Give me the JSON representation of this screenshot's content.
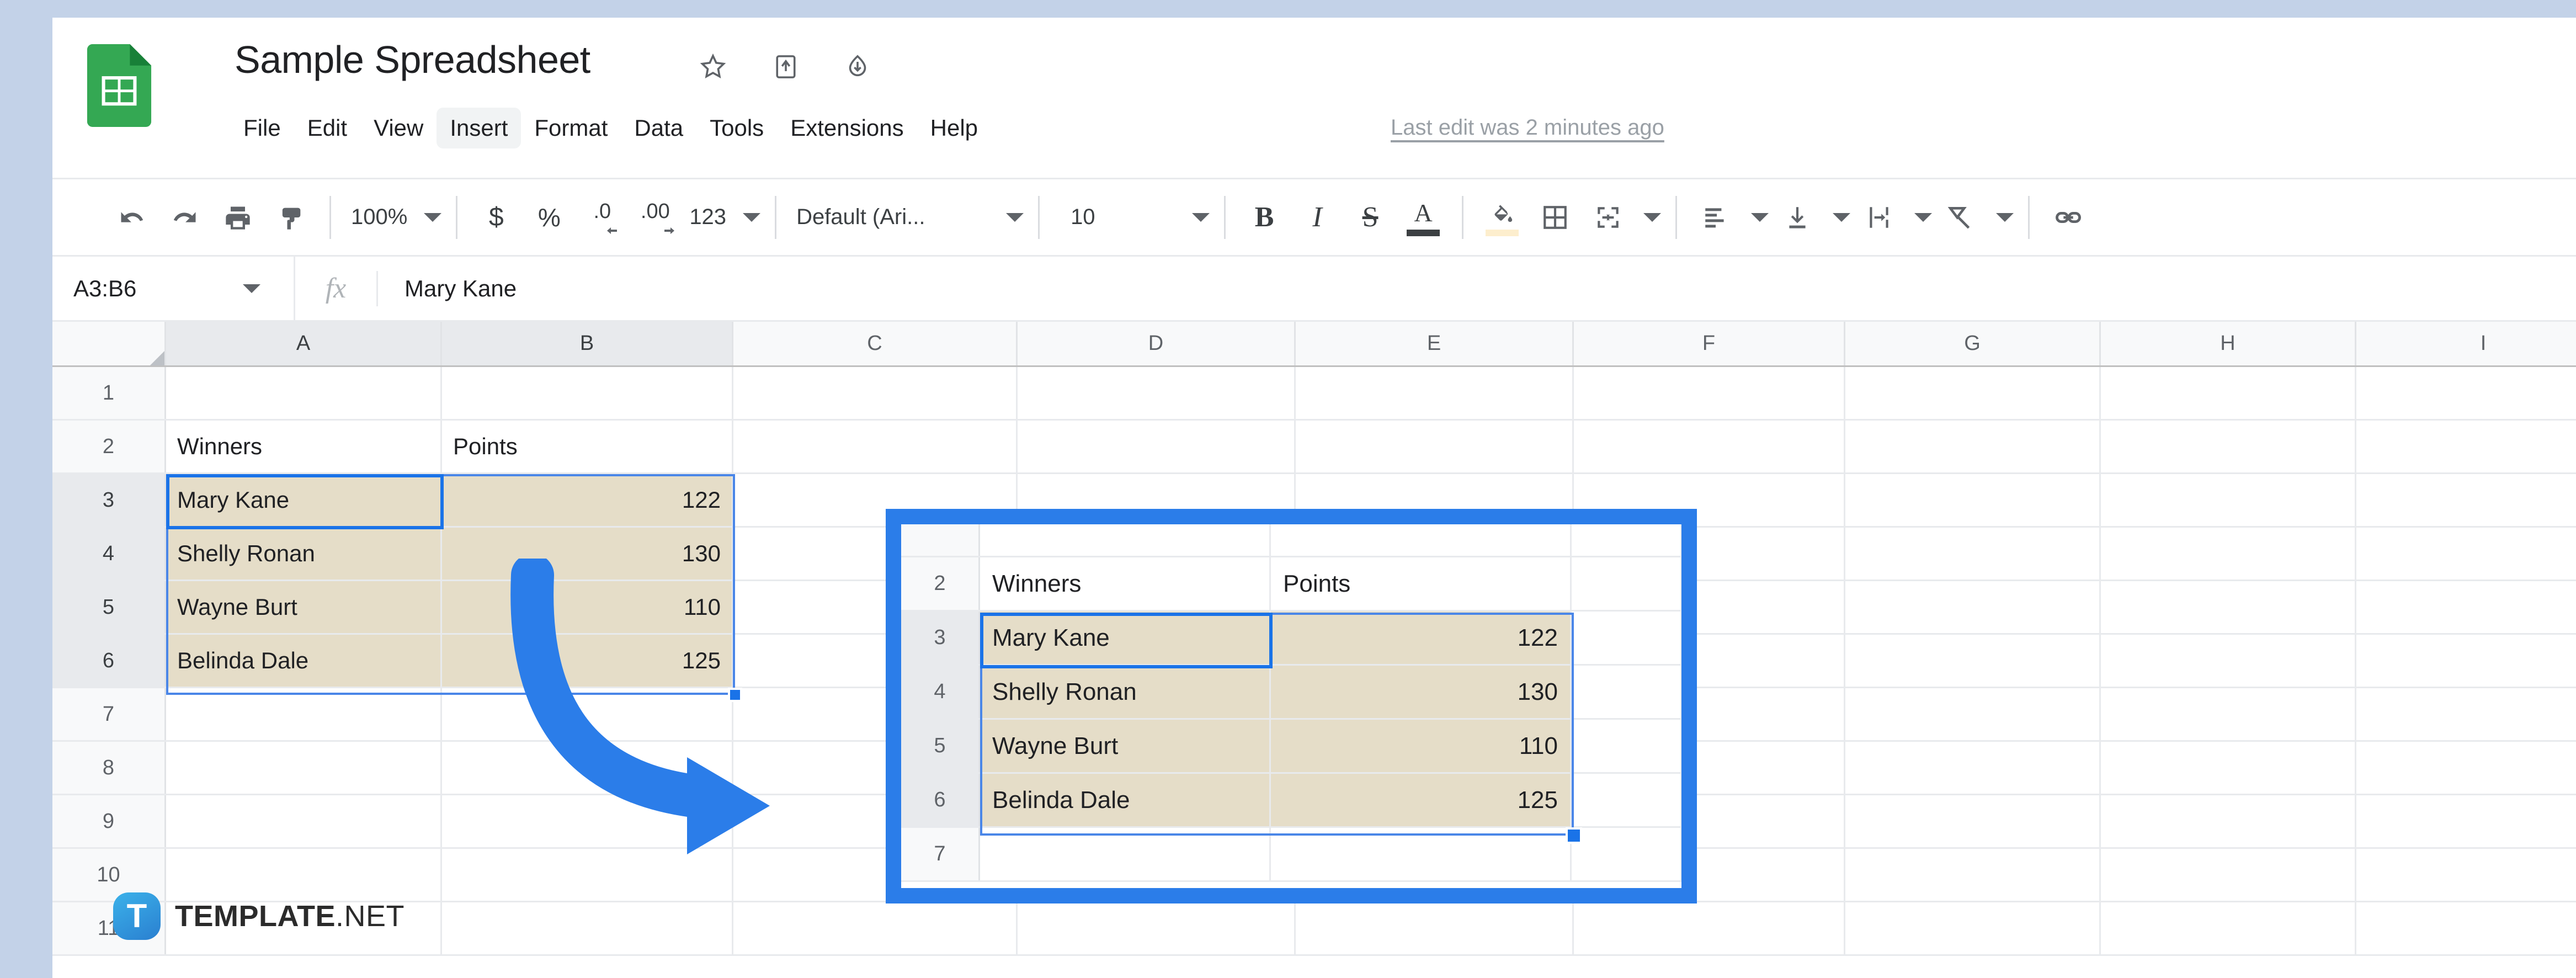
{
  "app": {
    "title": "Sample Spreadsheet",
    "logo_icon": "sheets-icon",
    "title_icons": [
      "star-icon",
      "move-to-folder-icon",
      "cloud-saved-icon"
    ],
    "last_edit": "Last edit was 2 minutes ago"
  },
  "menubar": [
    {
      "label": "File",
      "active": false
    },
    {
      "label": "Edit",
      "active": false
    },
    {
      "label": "View",
      "active": false
    },
    {
      "label": "Insert",
      "active": true
    },
    {
      "label": "Format",
      "active": false
    },
    {
      "label": "Data",
      "active": false
    },
    {
      "label": "Tools",
      "active": false
    },
    {
      "label": "Extensions",
      "active": false
    },
    {
      "label": "Help",
      "active": false
    }
  ],
  "toolbar": {
    "zoom_value": "100%",
    "number_format_value": "123",
    "font_value": "Default (Ari...",
    "font_size_value": "10",
    "icons": [
      "undo-icon",
      "redo-icon",
      "print-icon",
      "paint-format-icon",
      "currency-icon",
      "percent-icon",
      "decrease-decimal-icon",
      "increase-decimal-icon",
      "bold-icon",
      "italic-icon",
      "strikethrough-icon",
      "text-color-icon",
      "fill-color-icon",
      "borders-icon",
      "merge-cells-icon",
      "horizontal-align-icon",
      "vertical-align-icon",
      "text-wrap-icon",
      "text-rotation-icon",
      "insert-link-icon"
    ],
    "currency_label": "$",
    "percent_label": "%",
    "decrease_decimal_label": ".0",
    "increase_decimal_label": ".00"
  },
  "formula_bar": {
    "name_box": "A3:B6",
    "fx_label": "fx",
    "value": "Mary Kane"
  },
  "grid": {
    "columns": [
      "A",
      "B",
      "C",
      "D",
      "E",
      "F",
      "G",
      "H",
      "I"
    ],
    "selected_columns": [
      "A",
      "B"
    ],
    "rows": [
      "1",
      "2",
      "3",
      "4",
      "5",
      "6",
      "7",
      "8",
      "9",
      "10",
      "11"
    ],
    "selected_rows": [
      "3",
      "4",
      "5",
      "6"
    ],
    "cells": {
      "A2": "Winners",
      "B2": "Points",
      "A3": "Mary Kane",
      "B3": "122",
      "A4": "Shelly Ronan",
      "B4": "130",
      "A5": "Wayne Burt",
      "B5": "110",
      "A6": "Belinda Dale",
      "B6": "125"
    },
    "selection_range": "A3:B6",
    "active_cell": "A3",
    "fill_color": "#e5ddc8",
    "selection_color": "#1a73e8"
  },
  "callout": {
    "border_color": "#2b7de9",
    "rows": [
      {
        "num": "",
        "a": "",
        "b": "",
        "fill": false
      },
      {
        "num": "2",
        "a": "Winners",
        "b": "Points",
        "fill": false
      },
      {
        "num": "3",
        "a": "Mary Kane",
        "b": "122",
        "fill": true
      },
      {
        "num": "4",
        "a": "Shelly Ronan",
        "b": "130",
        "fill": true
      },
      {
        "num": "5",
        "a": "Wayne Burt",
        "b": "110",
        "fill": true
      },
      {
        "num": "6",
        "a": "Belinda Dale",
        "b": "125",
        "fill": true
      },
      {
        "num": "7",
        "a": "",
        "b": "",
        "fill": false
      }
    ],
    "active_cell": "Mary Kane"
  },
  "arrow": {
    "icon": "curved-arrow-icon",
    "color": "#2b7de9"
  },
  "watermark": {
    "mark_letter": "T",
    "name_bold": "TEMPLATE",
    "name_light": ".NET"
  }
}
